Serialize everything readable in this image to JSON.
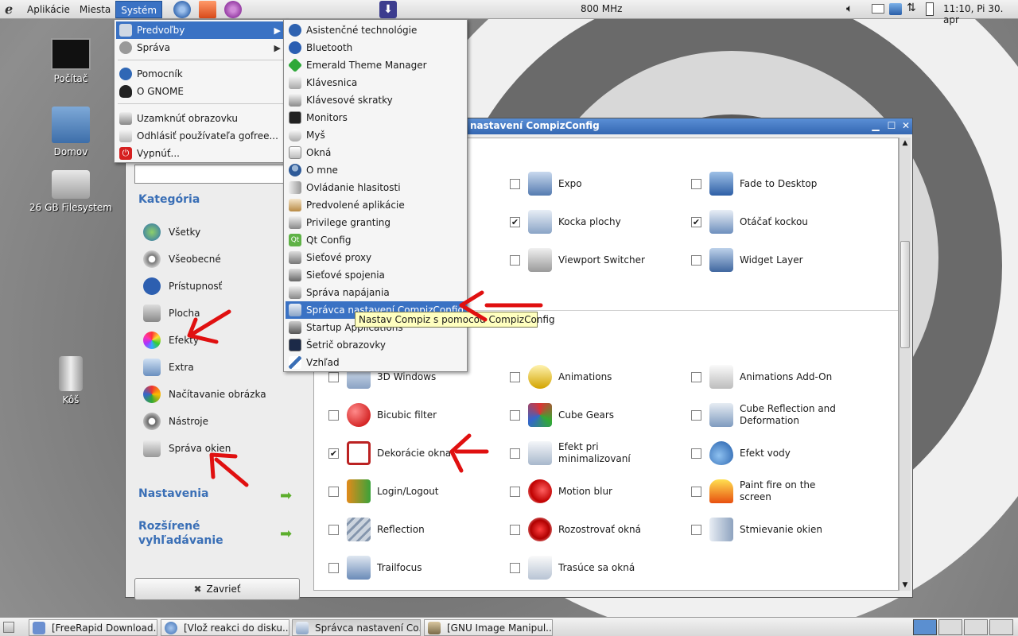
{
  "top_panel": {
    "menus": [
      "Aplikácie",
      "Miesta",
      "Systém"
    ],
    "cpu": "800 MHz",
    "clock": "11:10, Pi 30. apr"
  },
  "desktop": {
    "icons": [
      "Počítač",
      "Domov",
      "26 GB Filesystem",
      "Kôš"
    ]
  },
  "window": {
    "title": "Správca nastavení CompizConfig",
    "title_visible": "nastavení CompizConfig",
    "sidebar": {
      "category_heading": "Kategória",
      "categories": [
        "Všetky",
        "Všeobecné",
        "Prístupnosť",
        "Plocha",
        "Efekty",
        "Extra",
        "Načítavanie obrázka",
        "Nástroje",
        "Správa okien"
      ],
      "settings_label": "Nastavenia",
      "advanced_search_label": "Rozšírené vyhľadávanie",
      "close_label": "Zavrieť"
    },
    "plugins_top": [
      {
        "label": "Expo",
        "checked": false
      },
      {
        "label": "Fade to Desktop",
        "checked": false
      },
      {
        "label": "Kocka plochy",
        "checked": true
      },
      {
        "label": "Otáčať kockou",
        "checked": true
      },
      {
        "label": "Viewport Switcher",
        "checked": false
      },
      {
        "label": "Widget Layer",
        "checked": false
      }
    ],
    "plugins_effects": [
      {
        "label": "3D Windows",
        "checked": false
      },
      {
        "label": "Animations",
        "checked": false
      },
      {
        "label": "Animations Add-On",
        "checked": false
      },
      {
        "label": "Bicubic filter",
        "checked": false
      },
      {
        "label": "Cube Gears",
        "checked": false
      },
      {
        "label": "Cube Reflection and Deformation",
        "checked": false
      },
      {
        "label": "Dekorácie okna",
        "checked": true
      },
      {
        "label": "Efekt pri minimalizovaní",
        "checked": false
      },
      {
        "label": "Efekt vody",
        "checked": false
      },
      {
        "label": "Login/Logout",
        "checked": false
      },
      {
        "label": "Motion blur",
        "checked": false
      },
      {
        "label": "Paint fire on the screen",
        "checked": false
      },
      {
        "label": "Reflection",
        "checked": false
      },
      {
        "label": "Rozostrovať okná",
        "checked": false
      },
      {
        "label": "Stmievanie okien",
        "checked": false
      },
      {
        "label": "Trailfocus",
        "checked": false
      },
      {
        "label": "Trasúce sa okná",
        "checked": false
      }
    ]
  },
  "system_menu": {
    "items": [
      "Predvoľby",
      "Správa",
      "Pomocník",
      "O GNOME",
      "Uzamknúť obrazovku",
      "Odhlásiť používateľa gofree...",
      "Vypnúť..."
    ]
  },
  "preferences_menu": {
    "items": [
      "Asistenčné technológie",
      "Bluetooth",
      "Emerald Theme Manager",
      "Klávesnica",
      "Klávesové skratky",
      "Monitors",
      "Myš",
      "Okná",
      "O mne",
      "Ovládanie hlasitosti",
      "Predvolené aplikácie",
      "Privilege granting",
      "Qt Config",
      "Sieťové proxy",
      "Sieťové spojenia",
      "Správa napájania",
      "Správca nastavení CompizConfig",
      "Startup Applications",
      "Šetrič obrazovky",
      "Vzhľad"
    ],
    "tooltip": "Nastav Compiz s pomocou CompizConfig"
  },
  "taskbar": {
    "tasks": [
      "[FreeRapid Download...",
      "[Vlož reakci do disku...",
      "Správca nastavení Co...",
      "[GNU Image Manipul..."
    ]
  },
  "colors": {
    "selection": "#3a72c4",
    "heading": "#3a6fb6",
    "annotation": "#e01010"
  }
}
